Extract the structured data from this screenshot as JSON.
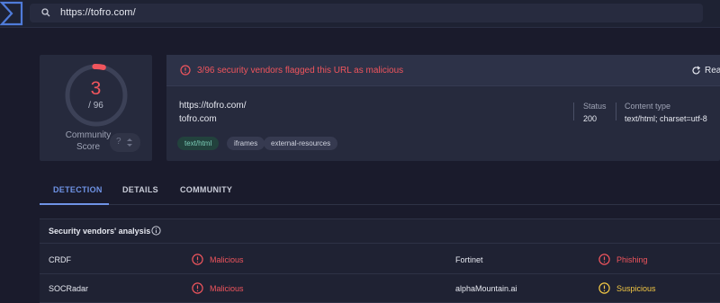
{
  "search": {
    "url": "https://tofro.com/"
  },
  "score": {
    "detections": "3",
    "total": "/ 96",
    "fraction": 0.03125,
    "community_label_line1": "Community",
    "community_label_line2": "Score",
    "community_value": "?"
  },
  "alert": {
    "text": "3/96 security vendors flagged this URL as malicious",
    "reanalyze_label": "Rean",
    "color": "#f0555d"
  },
  "details": {
    "url": "https://tofro.com/",
    "domain": "tofro.com",
    "tags": [
      "text/html",
      "iframes",
      "external-resources"
    ],
    "status_label": "Status",
    "status_value": "200",
    "content_type_label": "Content type",
    "content_type_value": "text/html; charset=utf-8"
  },
  "tabs": [
    {
      "label": "DETECTION",
      "active": true
    },
    {
      "label": "DETAILS",
      "active": false
    },
    {
      "label": "COMMUNITY",
      "active": false
    }
  ],
  "analysis": {
    "title": "Security vendors' analysis",
    "rows": [
      {
        "vendor1": "CRDF",
        "result1": "Malicious",
        "vendor2": "Fortinet",
        "result2": "Phishing"
      },
      {
        "vendor1": "SOCRadar",
        "result1": "Malicious",
        "vendor2": "alphaMountain.ai",
        "result2": "Suspicious"
      }
    ]
  },
  "colors": {
    "malicious": "#f0555d",
    "suspicious": "#f2c744",
    "accent": "#6f93e6",
    "tag_text_html": "#7ccdb8"
  }
}
